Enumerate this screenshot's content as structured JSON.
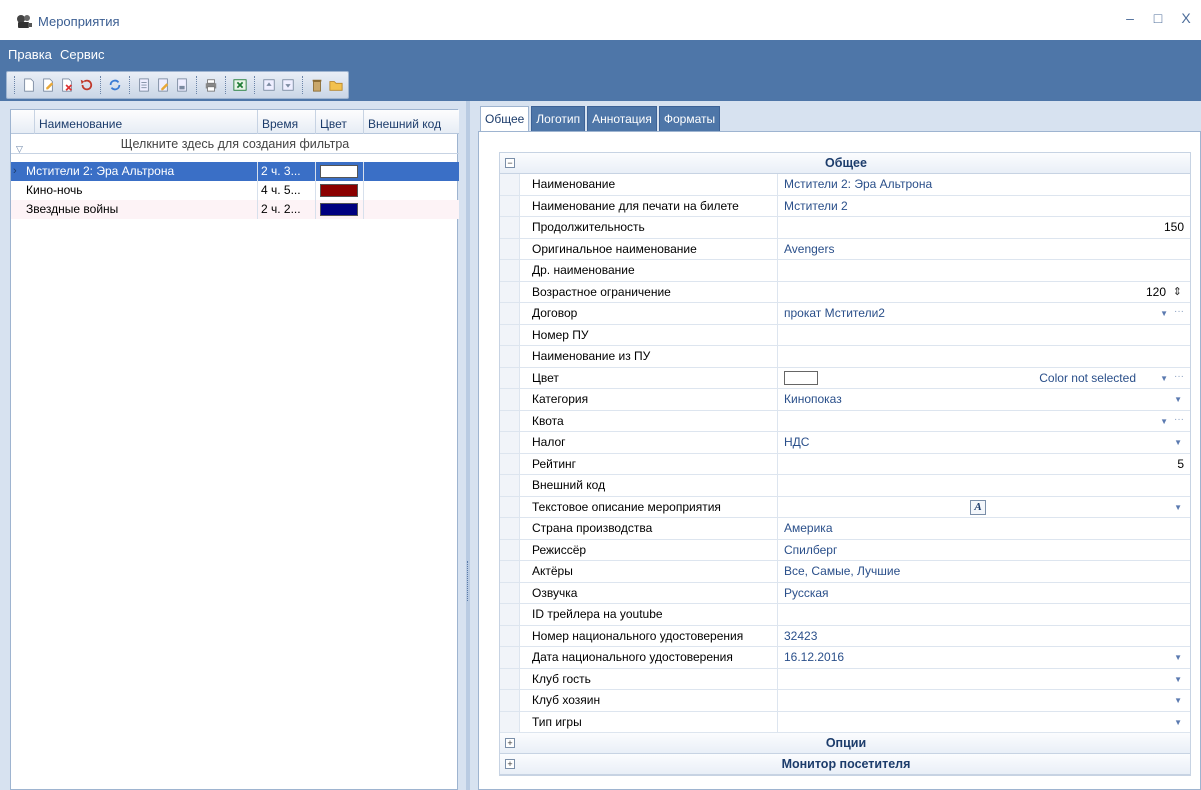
{
  "window": {
    "title": "Мероприятия",
    "controls": [
      "–",
      "□",
      "X"
    ]
  },
  "menu": {
    "items": [
      "Правка",
      "Сервис"
    ]
  },
  "toolbar": {
    "buttons": [
      {
        "icon": "new-document-icon"
      },
      {
        "icon": "edit-document-icon"
      },
      {
        "icon": "delete-document-icon"
      },
      {
        "icon": "undo-icon"
      },
      {
        "icon": "refresh-icon"
      },
      {
        "icon": "page-icon"
      },
      {
        "icon": "edit-page-icon"
      },
      {
        "icon": "save-page-icon"
      },
      {
        "icon": "print-icon"
      },
      {
        "icon": "excel-export-icon"
      },
      {
        "icon": "move-up-icon"
      },
      {
        "icon": "move-down-icon"
      },
      {
        "icon": "trash-icon"
      },
      {
        "icon": "folder-icon"
      }
    ]
  },
  "list": {
    "columns": [
      "Наименование",
      "Время",
      "Цвет",
      "Внешний код"
    ],
    "filter_hint": "Щелкните здесь для создания фильтра",
    "rows": [
      {
        "name": "Мстители 2: Эра Альтрона",
        "time": "2 ч. 3...",
        "color": "#ffffff",
        "code": "",
        "selected": true
      },
      {
        "name": "Кино-ночь",
        "time": "4 ч. 5...",
        "color": "#8b0000",
        "code": "",
        "selected": false
      },
      {
        "name": "Звездные войны",
        "time": "2 ч. 2...",
        "color": "#000080",
        "code": "",
        "selected": false
      }
    ]
  },
  "tabs": [
    "Общее",
    "Логотип",
    "Аннотация",
    "Форматы"
  ],
  "properties": {
    "category_general": "Общее",
    "category_options": "Опции",
    "category_monitor": "Монитор посетителя",
    "rows": [
      {
        "name": "Наименование",
        "value": "Мстители 2: Эра Альтрона"
      },
      {
        "name": "Наименование для печати на билете",
        "value": "Мстители 2"
      },
      {
        "name": "Продолжительность",
        "value": "150"
      },
      {
        "name": "Оригинальное наименование",
        "value": "Avengers"
      },
      {
        "name": "Др. наименование",
        "value": ""
      },
      {
        "name": "Возрастное ограничение",
        "value": "120"
      },
      {
        "name": "Договор",
        "value": "прокат Мстители2"
      },
      {
        "name": "Номер ПУ",
        "value": ""
      },
      {
        "name": "Наименование из ПУ",
        "value": ""
      },
      {
        "name": "Цвет",
        "value": "Color not selected"
      },
      {
        "name": "Категория",
        "value": "Кинопоказ"
      },
      {
        "name": "Квота",
        "value": ""
      },
      {
        "name": "Налог",
        "value": "НДС"
      },
      {
        "name": "Рейтинг",
        "value": "5"
      },
      {
        "name": "Внешний код",
        "value": ""
      },
      {
        "name": "Текстовое описание мероприятия",
        "value": ""
      },
      {
        "name": "Страна производства",
        "value": "Америка"
      },
      {
        "name": "Режиссёр",
        "value": "Спилберг"
      },
      {
        "name": "Актёры",
        "value": "Все, Самые, Лучшие"
      },
      {
        "name": "Озвучка",
        "value": "Русская"
      },
      {
        "name": "ID трейлера на youtube",
        "value": ""
      },
      {
        "name": "Номер национального удостоверения",
        "value": "32423"
      },
      {
        "name": "Дата национального удостоверения",
        "value": "16.12.2016"
      },
      {
        "name": "Клуб гость",
        "value": ""
      },
      {
        "name": "Клуб хозяин",
        "value": ""
      },
      {
        "name": "Тип игры",
        "value": ""
      }
    ]
  },
  "colors": {
    "accent": "#4e76a8",
    "selection": "#3a6fc6",
    "workspace": "#d7e2f0"
  }
}
